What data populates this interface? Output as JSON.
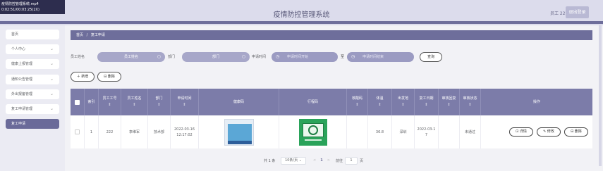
{
  "video": {
    "line1": "疫情防控管理系统.mp4",
    "line2": "0:02:51/00:03:25(2X)"
  },
  "header": {
    "title": "疫情防控管理系统",
    "user": "员工 222",
    "logout": "退出登录"
  },
  "sidebar": {
    "items": [
      {
        "label": "首页",
        "has_chevron": false
      },
      {
        "label": "个人中心",
        "has_chevron": true
      },
      {
        "label": "健康上报管理",
        "has_chevron": true
      },
      {
        "label": "通知公告管理",
        "has_chevron": true
      },
      {
        "label": "外出报备管理",
        "has_chevron": true
      },
      {
        "label": "复工申请管理",
        "has_chevron": true
      },
      {
        "label": "复工申请",
        "has_chevron": false,
        "active": true
      }
    ]
  },
  "breadcrumb": {
    "home": "首页",
    "sep": "/",
    "current": "复工申请"
  },
  "search": {
    "name_label": "员工姓名",
    "name_placeholder": "员工姓名",
    "dept_label": "部门",
    "dept_placeholder": "部门",
    "time_label": "申请时间",
    "start_placeholder": "申请时间开始",
    "range_sep": "至",
    "end_placeholder": "申请时间结束",
    "query_button": "查询"
  },
  "actions": {
    "add": "新增",
    "delete": "删除"
  },
  "table": {
    "columns": [
      "索引",
      "员工工号",
      "员工姓名",
      "部门",
      "申请时间",
      "健康码",
      "行程码",
      "核酸码",
      "体温",
      "出发地",
      "复工日期",
      "审核回复",
      "审核状态",
      "操作"
    ],
    "sort_glyph": "⇕",
    "row": {
      "index": "1",
      "emp_no": "222",
      "emp_name": "李维军",
      "dept": "技术部",
      "apply_time": "2022-03-16 12:17:02",
      "temp": "36.8",
      "origin": "深圳",
      "return_date": "2022-03-17",
      "reply": "",
      "status": "未通过",
      "ops": {
        "detail": "详情",
        "edit": "修改",
        "delete": "删除"
      }
    }
  },
  "pagination": {
    "total": "共 1 条",
    "page_size": "10条/页",
    "prev": "<",
    "current_page": "1",
    "next": ">",
    "goto_label": "前往",
    "goto_value": "1",
    "page_suffix": "页"
  },
  "colors": {
    "brand": "#6e6e9b",
    "header_bg": "#dcdcec",
    "table_head": "#7c7ca9",
    "input_pill": "#a7a7c9"
  }
}
